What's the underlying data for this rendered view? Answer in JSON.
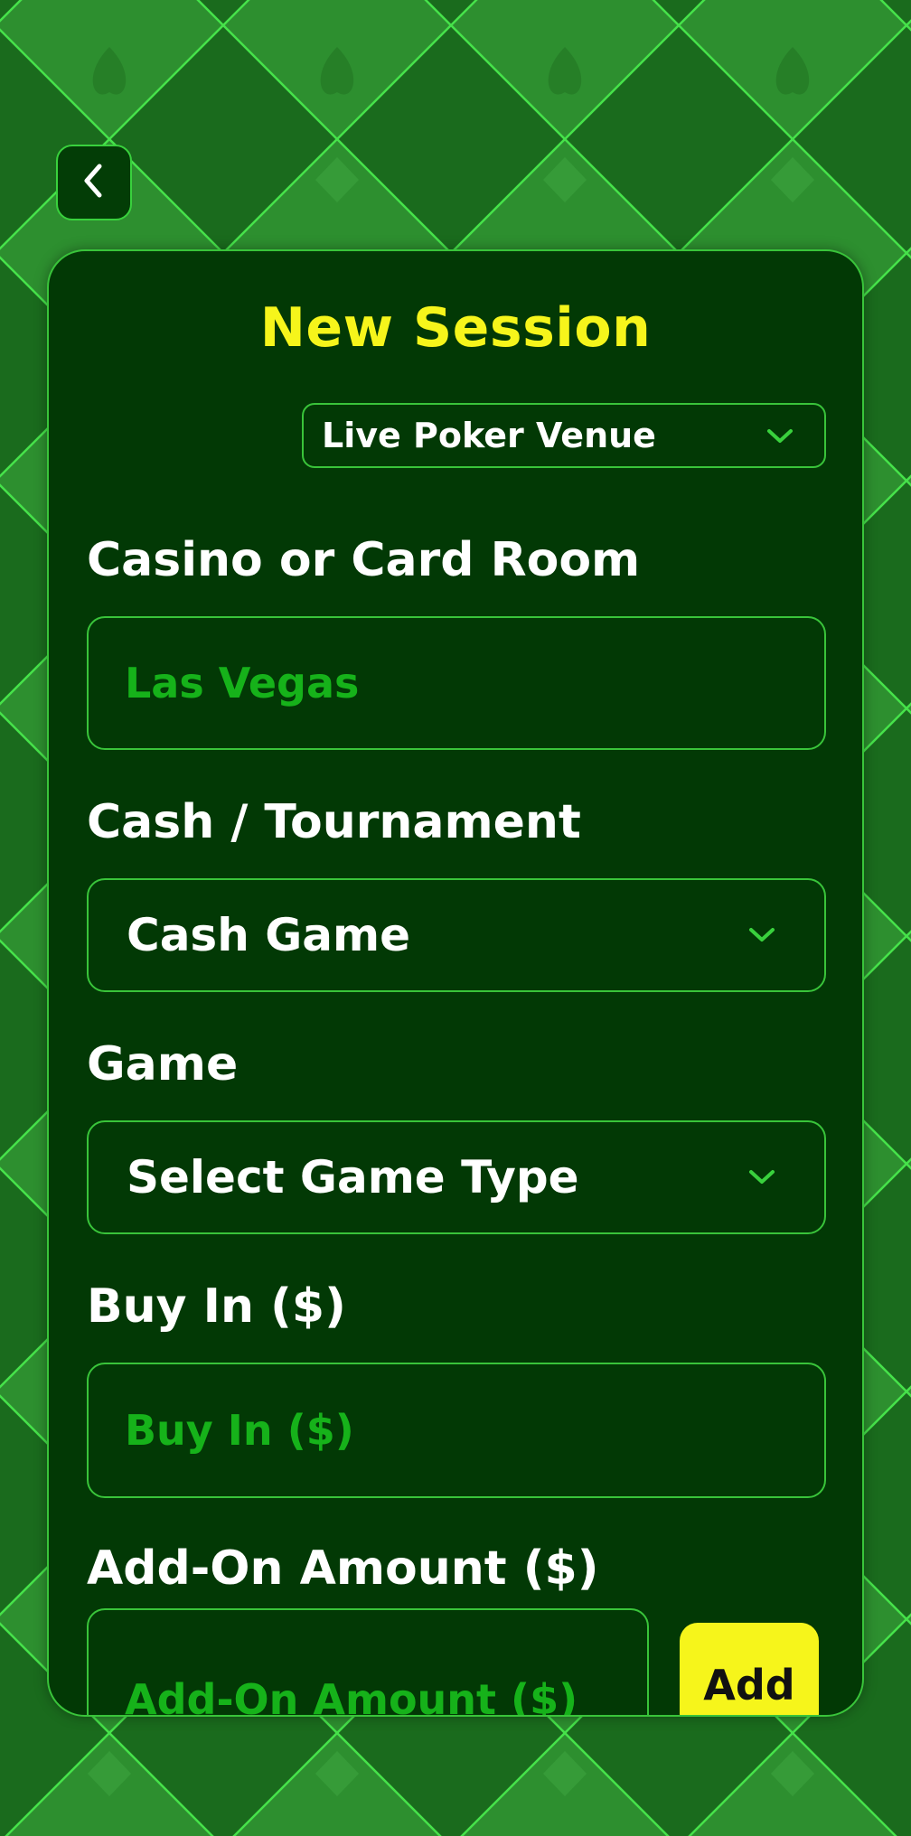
{
  "header": {
    "back_icon": "chevron-left-icon"
  },
  "form": {
    "title": "New Session",
    "venue_type": {
      "selected": "Live Poker Venue"
    },
    "casino": {
      "label": "Casino or Card Room",
      "value": "Las Vegas"
    },
    "session_type": {
      "label": "Cash / Tournament",
      "selected": "Cash Game"
    },
    "game": {
      "label": "Game",
      "selected": "Select Game Type"
    },
    "buy_in": {
      "label": "Buy In ($)",
      "placeholder": "Buy In ($)"
    },
    "add_on": {
      "label": "Add-On Amount ($)",
      "placeholder": "Add-On Amount ($)",
      "button_label": "Add"
    }
  },
  "colors": {
    "accent_yellow": "#f6f51b",
    "border_green": "#39c43a",
    "panel_bg": "#023905",
    "placeholder_green": "#16b21a"
  }
}
